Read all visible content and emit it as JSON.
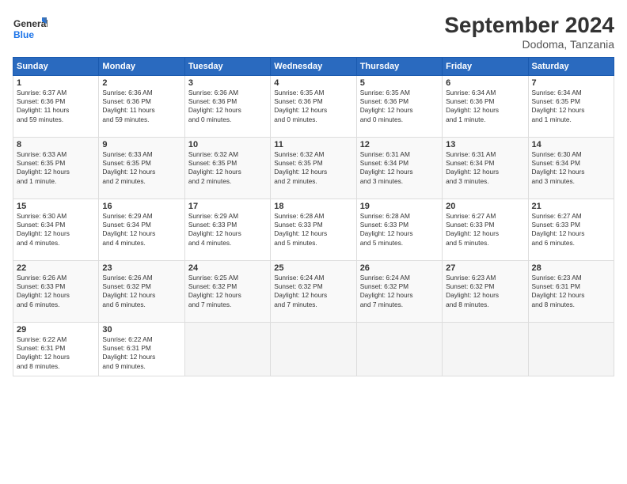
{
  "header": {
    "logo_general": "General",
    "logo_blue": "Blue",
    "title": "September 2024",
    "subtitle": "Dodoma, Tanzania"
  },
  "days_of_week": [
    "Sunday",
    "Monday",
    "Tuesday",
    "Wednesday",
    "Thursday",
    "Friday",
    "Saturday"
  ],
  "weeks": [
    [
      {
        "num": "1",
        "lines": [
          "Sunrise: 6:37 AM",
          "Sunset: 6:36 PM",
          "Daylight: 11 hours",
          "and 59 minutes."
        ]
      },
      {
        "num": "2",
        "lines": [
          "Sunrise: 6:36 AM",
          "Sunset: 6:36 PM",
          "Daylight: 11 hours",
          "and 59 minutes."
        ]
      },
      {
        "num": "3",
        "lines": [
          "Sunrise: 6:36 AM",
          "Sunset: 6:36 PM",
          "Daylight: 12 hours",
          "and 0 minutes."
        ]
      },
      {
        "num": "4",
        "lines": [
          "Sunrise: 6:35 AM",
          "Sunset: 6:36 PM",
          "Daylight: 12 hours",
          "and 0 minutes."
        ]
      },
      {
        "num": "5",
        "lines": [
          "Sunrise: 6:35 AM",
          "Sunset: 6:36 PM",
          "Daylight: 12 hours",
          "and 0 minutes."
        ]
      },
      {
        "num": "6",
        "lines": [
          "Sunrise: 6:34 AM",
          "Sunset: 6:36 PM",
          "Daylight: 12 hours",
          "and 1 minute."
        ]
      },
      {
        "num": "7",
        "lines": [
          "Sunrise: 6:34 AM",
          "Sunset: 6:35 PM",
          "Daylight: 12 hours",
          "and 1 minute."
        ]
      }
    ],
    [
      {
        "num": "8",
        "lines": [
          "Sunrise: 6:33 AM",
          "Sunset: 6:35 PM",
          "Daylight: 12 hours",
          "and 1 minute."
        ]
      },
      {
        "num": "9",
        "lines": [
          "Sunrise: 6:33 AM",
          "Sunset: 6:35 PM",
          "Daylight: 12 hours",
          "and 2 minutes."
        ]
      },
      {
        "num": "10",
        "lines": [
          "Sunrise: 6:32 AM",
          "Sunset: 6:35 PM",
          "Daylight: 12 hours",
          "and 2 minutes."
        ]
      },
      {
        "num": "11",
        "lines": [
          "Sunrise: 6:32 AM",
          "Sunset: 6:35 PM",
          "Daylight: 12 hours",
          "and 2 minutes."
        ]
      },
      {
        "num": "12",
        "lines": [
          "Sunrise: 6:31 AM",
          "Sunset: 6:34 PM",
          "Daylight: 12 hours",
          "and 3 minutes."
        ]
      },
      {
        "num": "13",
        "lines": [
          "Sunrise: 6:31 AM",
          "Sunset: 6:34 PM",
          "Daylight: 12 hours",
          "and 3 minutes."
        ]
      },
      {
        "num": "14",
        "lines": [
          "Sunrise: 6:30 AM",
          "Sunset: 6:34 PM",
          "Daylight: 12 hours",
          "and 3 minutes."
        ]
      }
    ],
    [
      {
        "num": "15",
        "lines": [
          "Sunrise: 6:30 AM",
          "Sunset: 6:34 PM",
          "Daylight: 12 hours",
          "and 4 minutes."
        ]
      },
      {
        "num": "16",
        "lines": [
          "Sunrise: 6:29 AM",
          "Sunset: 6:34 PM",
          "Daylight: 12 hours",
          "and 4 minutes."
        ]
      },
      {
        "num": "17",
        "lines": [
          "Sunrise: 6:29 AM",
          "Sunset: 6:33 PM",
          "Daylight: 12 hours",
          "and 4 minutes."
        ]
      },
      {
        "num": "18",
        "lines": [
          "Sunrise: 6:28 AM",
          "Sunset: 6:33 PM",
          "Daylight: 12 hours",
          "and 5 minutes."
        ]
      },
      {
        "num": "19",
        "lines": [
          "Sunrise: 6:28 AM",
          "Sunset: 6:33 PM",
          "Daylight: 12 hours",
          "and 5 minutes."
        ]
      },
      {
        "num": "20",
        "lines": [
          "Sunrise: 6:27 AM",
          "Sunset: 6:33 PM",
          "Daylight: 12 hours",
          "and 5 minutes."
        ]
      },
      {
        "num": "21",
        "lines": [
          "Sunrise: 6:27 AM",
          "Sunset: 6:33 PM",
          "Daylight: 12 hours",
          "and 6 minutes."
        ]
      }
    ],
    [
      {
        "num": "22",
        "lines": [
          "Sunrise: 6:26 AM",
          "Sunset: 6:33 PM",
          "Daylight: 12 hours",
          "and 6 minutes."
        ]
      },
      {
        "num": "23",
        "lines": [
          "Sunrise: 6:26 AM",
          "Sunset: 6:32 PM",
          "Daylight: 12 hours",
          "and 6 minutes."
        ]
      },
      {
        "num": "24",
        "lines": [
          "Sunrise: 6:25 AM",
          "Sunset: 6:32 PM",
          "Daylight: 12 hours",
          "and 7 minutes."
        ]
      },
      {
        "num": "25",
        "lines": [
          "Sunrise: 6:24 AM",
          "Sunset: 6:32 PM",
          "Daylight: 12 hours",
          "and 7 minutes."
        ]
      },
      {
        "num": "26",
        "lines": [
          "Sunrise: 6:24 AM",
          "Sunset: 6:32 PM",
          "Daylight: 12 hours",
          "and 7 minutes."
        ]
      },
      {
        "num": "27",
        "lines": [
          "Sunrise: 6:23 AM",
          "Sunset: 6:32 PM",
          "Daylight: 12 hours",
          "and 8 minutes."
        ]
      },
      {
        "num": "28",
        "lines": [
          "Sunrise: 6:23 AM",
          "Sunset: 6:31 PM",
          "Daylight: 12 hours",
          "and 8 minutes."
        ]
      }
    ],
    [
      {
        "num": "29",
        "lines": [
          "Sunrise: 6:22 AM",
          "Sunset: 6:31 PM",
          "Daylight: 12 hours",
          "and 8 minutes."
        ]
      },
      {
        "num": "30",
        "lines": [
          "Sunrise: 6:22 AM",
          "Sunset: 6:31 PM",
          "Daylight: 12 hours",
          "and 9 minutes."
        ]
      },
      null,
      null,
      null,
      null,
      null
    ]
  ]
}
